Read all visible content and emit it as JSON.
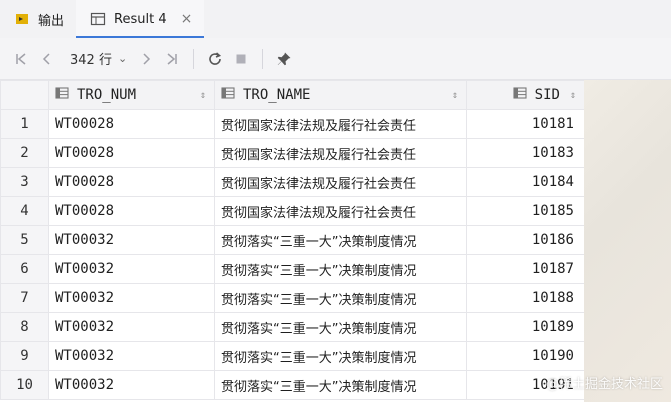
{
  "tabs": [
    {
      "label": "输出"
    },
    {
      "label": "Result 4",
      "close": "×"
    }
  ],
  "toolbar": {
    "row_count": "342 行",
    "row_count_caret": "⌄"
  },
  "columns": [
    {
      "label": "TRO_NUM",
      "sort": "⇕"
    },
    {
      "label": "TRO_NAME",
      "sort": "⇕"
    },
    {
      "label": "SID",
      "sort": "⇕"
    }
  ],
  "rows": [
    {
      "n": "1",
      "tro_num": "WT00028",
      "tro_name": "贯彻国家法律法规及履行社会责任",
      "sid": "10181"
    },
    {
      "n": "2",
      "tro_num": "WT00028",
      "tro_name": "贯彻国家法律法规及履行社会责任",
      "sid": "10183"
    },
    {
      "n": "3",
      "tro_num": "WT00028",
      "tro_name": "贯彻国家法律法规及履行社会责任",
      "sid": "10184"
    },
    {
      "n": "4",
      "tro_num": "WT00028",
      "tro_name": "贯彻国家法律法规及履行社会责任",
      "sid": "10185"
    },
    {
      "n": "5",
      "tro_num": "WT00032",
      "tro_name": "贯彻落实“三重一大”决策制度情况",
      "sid": "10186"
    },
    {
      "n": "6",
      "tro_num": "WT00032",
      "tro_name": "贯彻落实“三重一大”决策制度情况",
      "sid": "10187"
    },
    {
      "n": "7",
      "tro_num": "WT00032",
      "tro_name": "贯彻落实“三重一大”决策制度情况",
      "sid": "10188"
    },
    {
      "n": "8",
      "tro_num": "WT00032",
      "tro_name": "贯彻落实“三重一大”决策制度情况",
      "sid": "10189"
    },
    {
      "n": "9",
      "tro_num": "WT00032",
      "tro_name": "贯彻落实“三重一大”决策制度情况",
      "sid": "10190"
    },
    {
      "n": "10",
      "tro_num": "WT00032",
      "tro_name": "贯彻落实“三重一大”决策制度情况",
      "sid": "10191"
    }
  ],
  "watermark": "@稀土掘金技术社区",
  "colors": {
    "accent": "#3c78d8"
  }
}
